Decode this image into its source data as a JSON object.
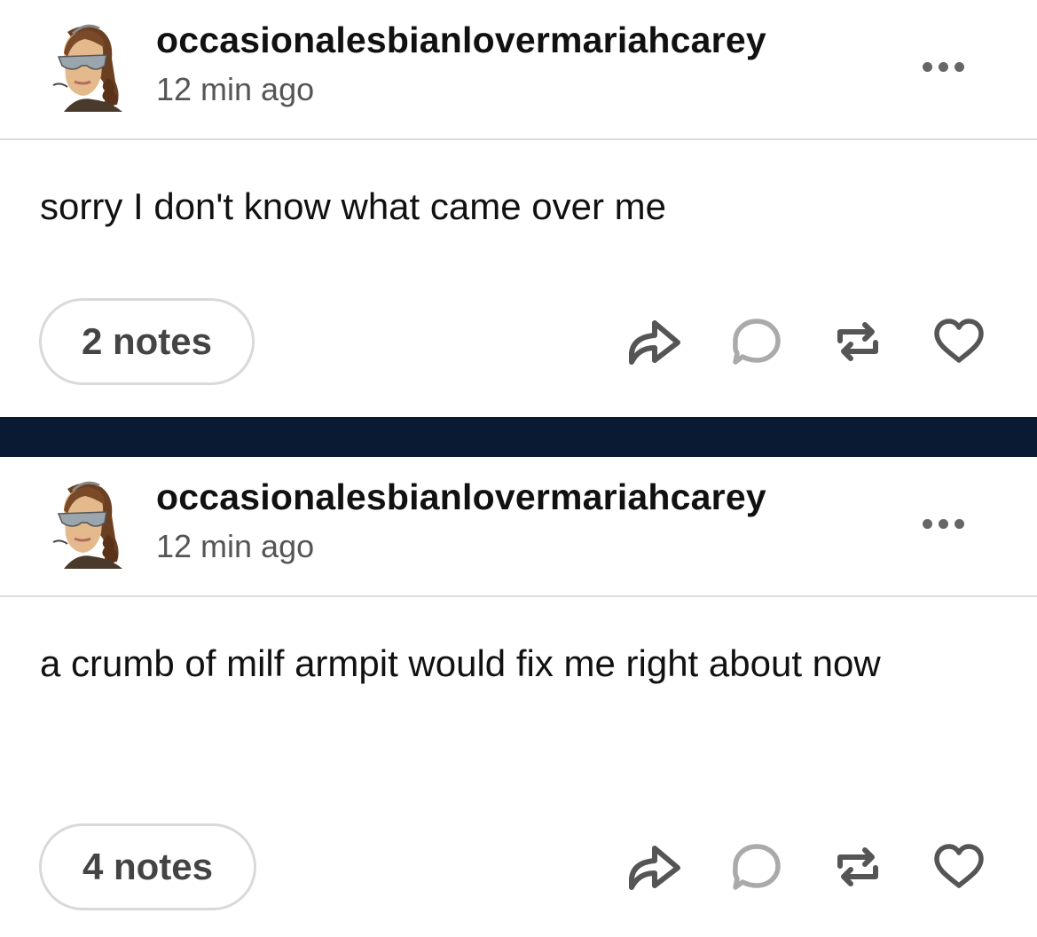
{
  "posts": [
    {
      "username": "occasionalesbianlovermariahcarey",
      "timestamp": "12 min ago",
      "body": "sorry I don't know what came over me",
      "notes": "2 notes"
    },
    {
      "username": "occasionalesbianlovermariahcarey",
      "timestamp": "12 min ago",
      "body": "a crumb of milf armpit would fix me right about now",
      "notes": "4 notes"
    }
  ],
  "icons": {
    "more": "more-horizontal-icon",
    "share": "share-arrow-icon",
    "reply": "speech-bubble-icon",
    "reblog": "reblog-icon",
    "like": "heart-icon"
  },
  "colors": {
    "divider_band": "#0b1a33",
    "icon_gray": "#555555",
    "reply_gray": "#aaaaaa",
    "notes_border": "#d9d9d9"
  }
}
